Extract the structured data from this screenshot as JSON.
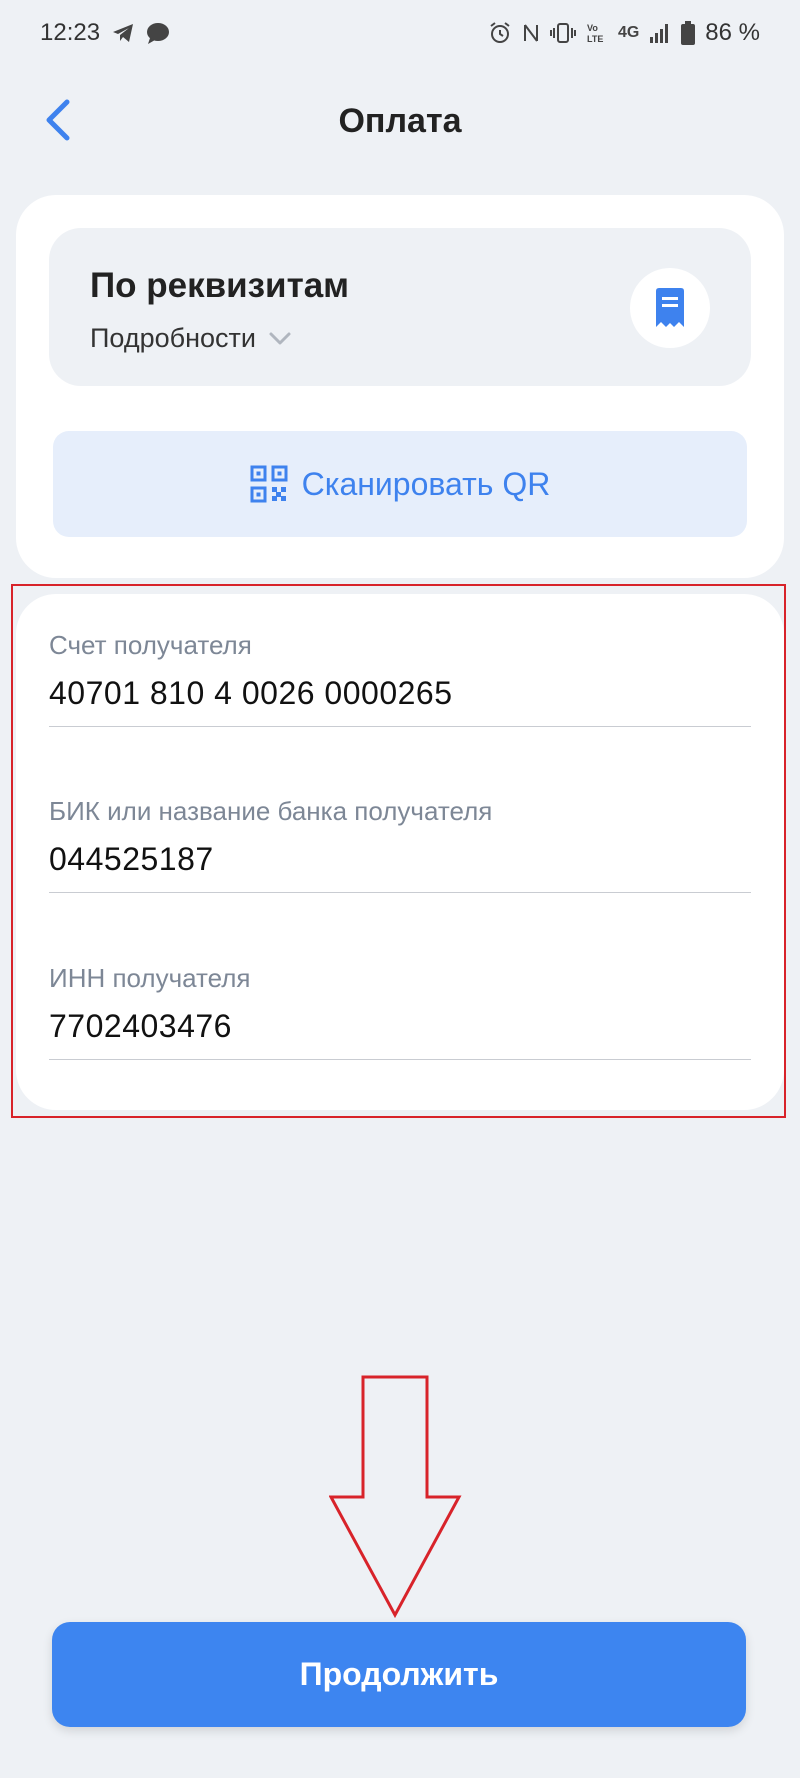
{
  "status_bar": {
    "time": "12:23",
    "network": "4G",
    "battery": "86 %",
    "icons": [
      "telegram-icon",
      "chat-icon",
      "alarm-icon",
      "nfc-icon",
      "vibrate-icon",
      "volte-icon",
      "signal-icon",
      "battery-icon"
    ]
  },
  "header": {
    "title": "Оплата",
    "back_icon": "chevron-left-icon"
  },
  "method": {
    "title": "По реквизитам",
    "details_label": "Подробности",
    "icon": "receipt-icon"
  },
  "scan": {
    "label": "Сканировать QR",
    "icon": "qr-code-icon"
  },
  "fields": [
    {
      "label": "Счет получателя",
      "value": "40701 810 4 0026 0000265"
    },
    {
      "label": "БИК или название банка получателя",
      "value": "044525187"
    },
    {
      "label": "ИНН получателя",
      "value": "7702403476"
    }
  ],
  "continue_button": {
    "label": "Продолжить"
  },
  "colors": {
    "accent": "#3d85f0",
    "background": "#eef1f5",
    "annotation": "#d8232a"
  }
}
